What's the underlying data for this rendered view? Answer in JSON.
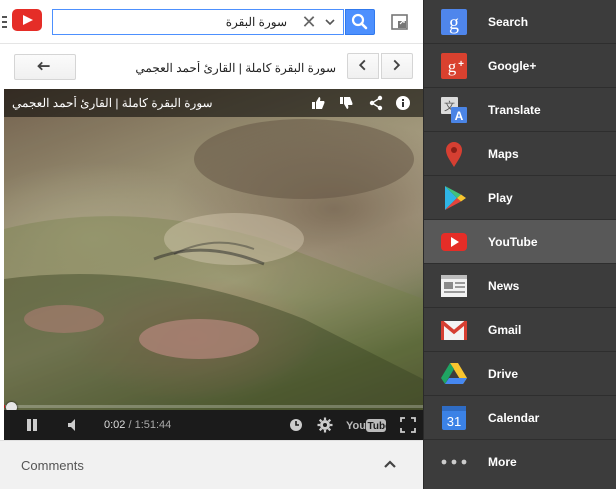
{
  "search": {
    "value": "سورة البقرة",
    "clear_symbol": "✕"
  },
  "video": {
    "title": "سورة البقرة كاملة | القارئ أحمد العجمي",
    "overlay_title": "سورة البقرة كاملة | القارئ أحمد العجمي",
    "current_time": "0:02",
    "separator": " / ",
    "duration": "1:51:44",
    "progress": 0.0003
  },
  "comments": {
    "label": "Comments"
  },
  "menu": {
    "items": [
      {
        "id": "search",
        "label": "Search"
      },
      {
        "id": "googleplus",
        "label": "Google+"
      },
      {
        "id": "translate",
        "label": "Translate"
      },
      {
        "id": "maps",
        "label": "Maps"
      },
      {
        "id": "play",
        "label": "Play"
      },
      {
        "id": "youtube",
        "label": "YouTube",
        "active": true
      },
      {
        "id": "news",
        "label": "News"
      },
      {
        "id": "gmail",
        "label": "Gmail"
      },
      {
        "id": "drive",
        "label": "Drive"
      },
      {
        "id": "calendar",
        "label": "Calendar",
        "icon_text": "31"
      },
      {
        "id": "more",
        "label": "More"
      }
    ]
  },
  "colors": {
    "accent_blue": "#4d90fe",
    "youtube_red": "#e52d27",
    "menu_bg": "#3c3c3c",
    "menu_active": "#585858"
  }
}
